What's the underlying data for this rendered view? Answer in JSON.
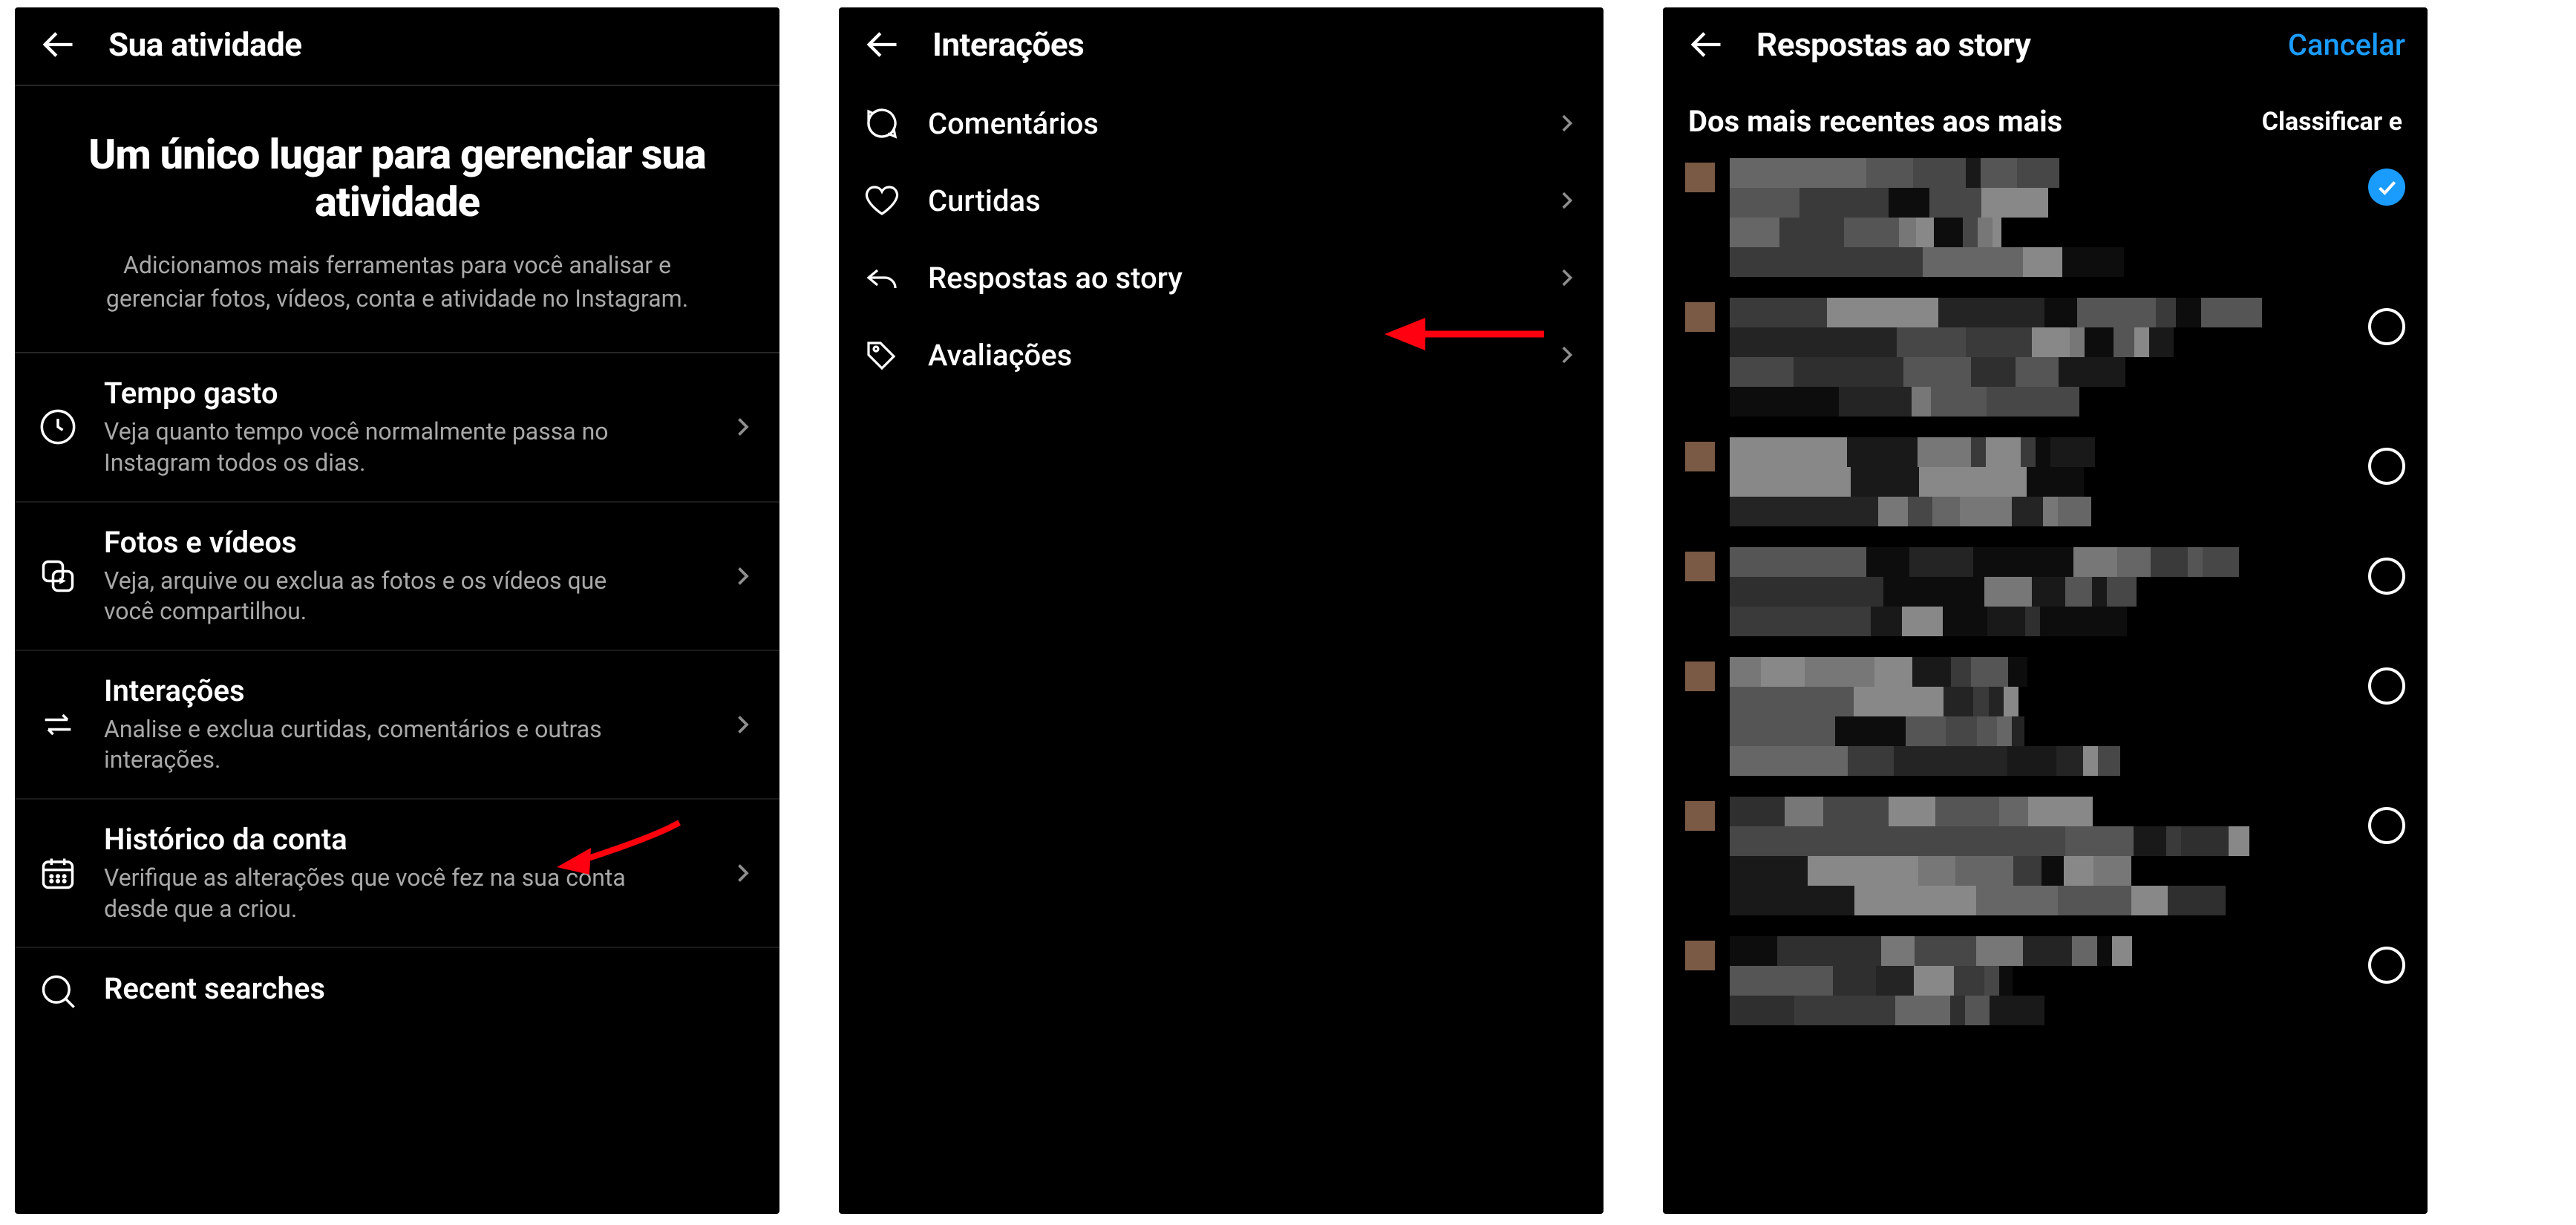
{
  "panel1": {
    "header": {
      "title": "Sua atividade"
    },
    "intro": {
      "heading": "Um único lugar para gerenciar sua atividade",
      "desc": "Adicionamos mais ferramentas para você analisar e gerenciar fotos, vídeos, conta e atividade no Instagram."
    },
    "rows": [
      {
        "icon": "clock-icon",
        "title": "Tempo gasto",
        "sub": "Veja quanto tempo você normalmente passa no Instagram todos os dias."
      },
      {
        "icon": "media-icon",
        "title": "Fotos e vídeos",
        "sub": "Veja, arquive ou exclua as fotos e os vídeos que você compartilhou."
      },
      {
        "icon": "arrows-swap-icon",
        "title": "Interações",
        "sub": "Analise e exclua curtidas, comentários e outras interações."
      },
      {
        "icon": "calendar-icon",
        "title": "Histórico da conta",
        "sub": "Verifique as alterações que você fez na sua conta desde que a criou."
      },
      {
        "icon": "search-icon",
        "title": "Recent searches",
        "sub": ""
      }
    ]
  },
  "panel2": {
    "header": {
      "title": "Interações"
    },
    "items": [
      {
        "icon": "comment-icon",
        "label": "Comentários"
      },
      {
        "icon": "heart-icon",
        "label": "Curtidas"
      },
      {
        "icon": "reply-icon",
        "label": "Respostas ao story"
      },
      {
        "icon": "tag-icon",
        "label": "Avaliações"
      }
    ]
  },
  "panel3": {
    "header": {
      "title": "Respostas ao story",
      "action": "Cancelar"
    },
    "subheader": {
      "left": "Dos mais recentes aos mais",
      "right": "Classificar e"
    },
    "item_count": 7,
    "colors": {
      "accent": "#1a9cff"
    }
  }
}
